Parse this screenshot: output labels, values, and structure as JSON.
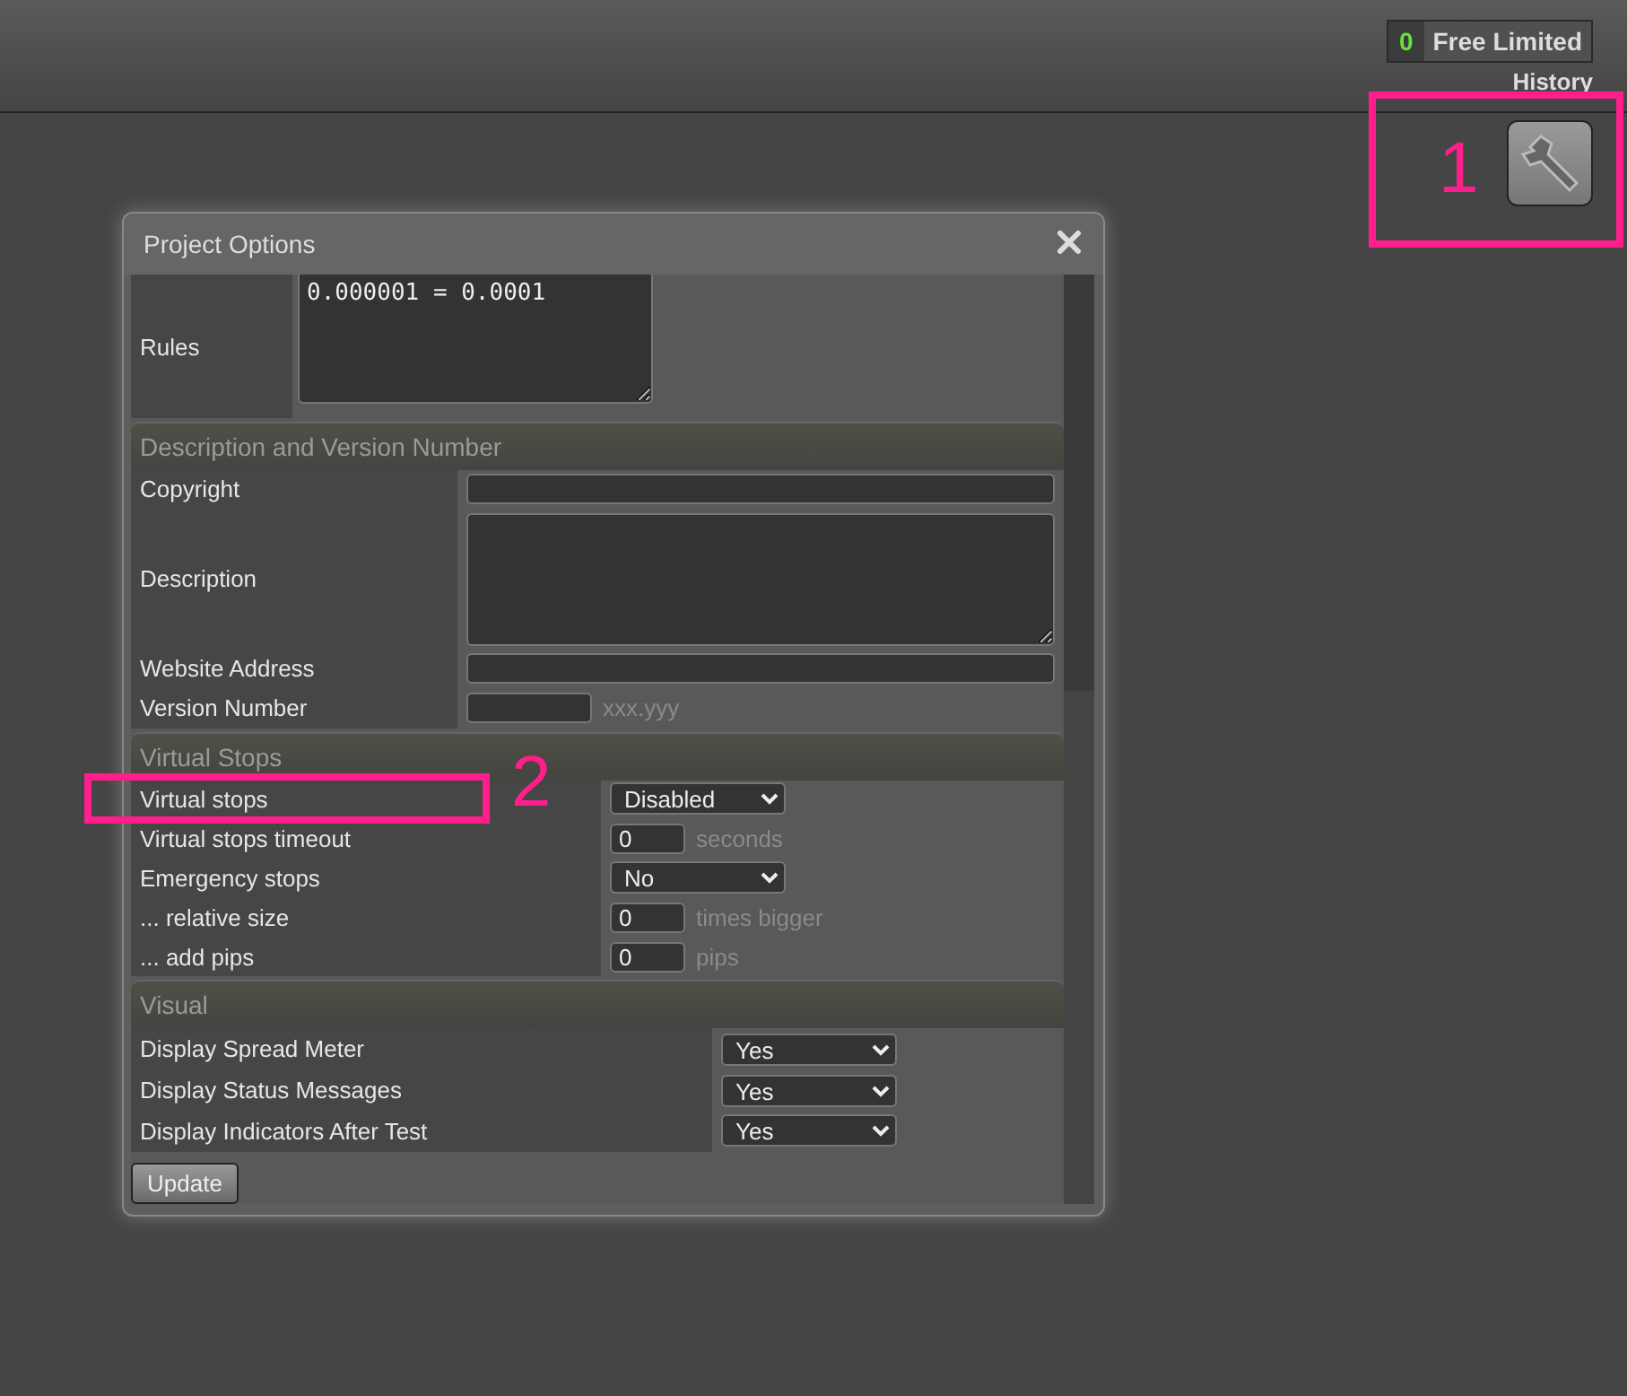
{
  "header": {
    "plan_badge": {
      "count": "0",
      "label": "Free Limited"
    },
    "history_link": "History"
  },
  "dialog": {
    "title": "Project Options",
    "rules": {
      "label": "Rules",
      "value": "0.000001 = 0.0001"
    },
    "sections": [
      {
        "title": "Description and Version Number",
        "rows": [
          {
            "label": "Copyright",
            "kind": "text",
            "value": ""
          },
          {
            "label": "Description",
            "kind": "textarea",
            "value": ""
          },
          {
            "label": "Website Address",
            "kind": "text",
            "value": ""
          },
          {
            "label": "Version Number",
            "kind": "short",
            "value": "",
            "hint": "xxx.yyy"
          }
        ]
      },
      {
        "title": "Virtual Stops",
        "rows": [
          {
            "label": "Virtual stops",
            "kind": "select",
            "value": "Disabled"
          },
          {
            "label": "Virtual stops timeout",
            "kind": "short",
            "value": "0",
            "hint": "seconds"
          },
          {
            "label": "Emergency stops",
            "kind": "select",
            "value": "No"
          },
          {
            "label": "... relative size",
            "kind": "short",
            "value": "0",
            "hint": "times bigger"
          },
          {
            "label": "... add pips",
            "kind": "short",
            "value": "0",
            "hint": "pips"
          }
        ]
      },
      {
        "title": "Visual",
        "rows": [
          {
            "label": "Display Spread Meter",
            "kind": "select",
            "value": "Yes"
          },
          {
            "label": "Display Status Messages",
            "kind": "select",
            "value": "Yes"
          },
          {
            "label": "Display Indicators After Test",
            "kind": "select",
            "value": "Yes"
          }
        ]
      }
    ],
    "update_button": "Update"
  },
  "annotations": [
    {
      "number": "1"
    },
    {
      "number": "2"
    }
  ]
}
